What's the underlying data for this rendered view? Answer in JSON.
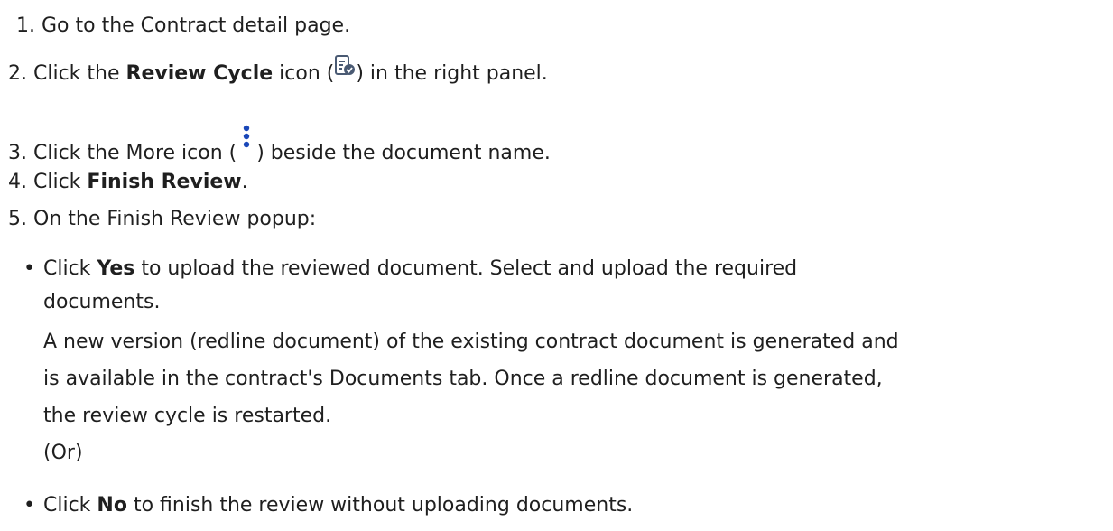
{
  "steps": [
    {
      "number": "1.",
      "text": "Go to the Contract detail page."
    },
    {
      "number": "2.",
      "pre": "Click the ",
      "bold": "Review Cycle",
      "mid": " icon (",
      "icon": "review-cycle-icon",
      "post": ") in the right panel."
    },
    {
      "number": "3.",
      "pre": "Click the More icon (",
      "icon": "more-vertical-icon",
      "post": ") beside the document name."
    },
    {
      "number": "4.",
      "pre": "Click ",
      "bold": "Finish Review",
      "post": "."
    },
    {
      "number": "5.",
      "text": "On the Finish Review popup:"
    }
  ],
  "options": [
    {
      "bullet": "•",
      "pre": "Click ",
      "bold": "Yes",
      "post_line1": " to upload the reviewed document. Select and upload the required",
      "line2": "documents.",
      "line3": "A new version (redline document) of the existing contract document is generated and",
      "line4": "is available in the contract's Documents tab. Once a redline document is generated,",
      "line5": "the review cycle is restarted.",
      "line6": "(Or)"
    },
    {
      "bullet": "•",
      "pre": "Click ",
      "bold": "No",
      "post": " to finish the review without uploading documents."
    }
  ],
  "colors": {
    "text": "#1f1f1f",
    "icon_blue": "#1a47b8",
    "icon_gray": "#4a5a73"
  }
}
